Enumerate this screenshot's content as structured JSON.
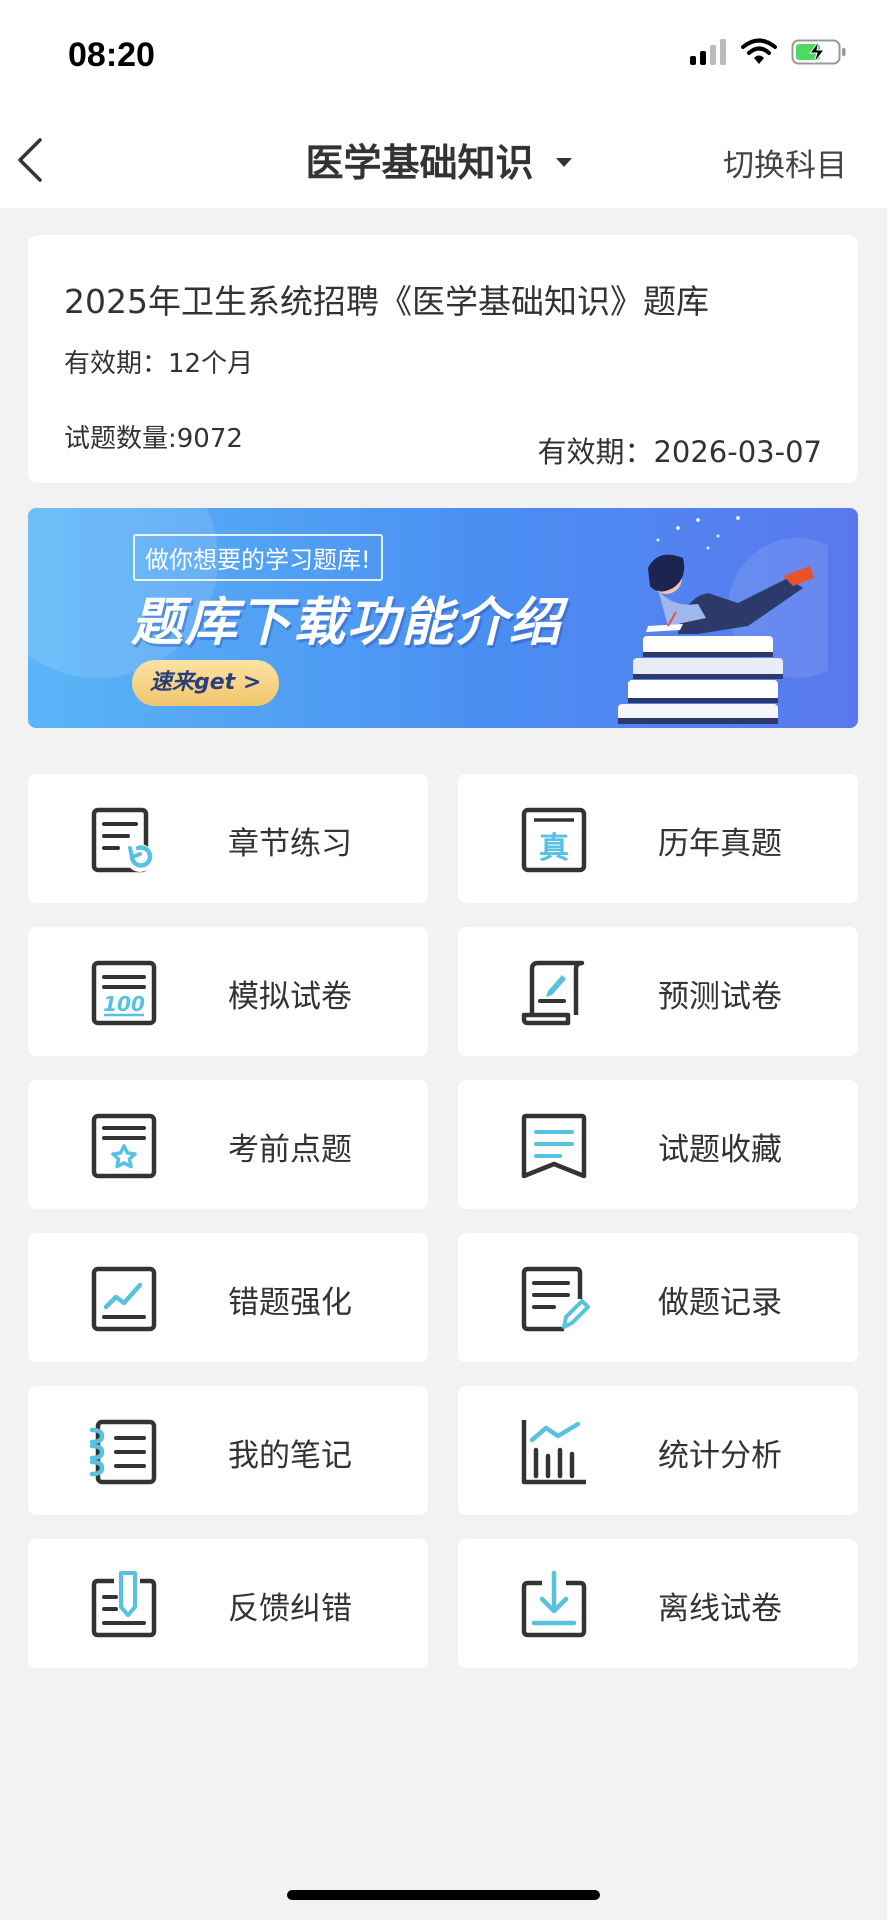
{
  "status_bar": {
    "time": "08:20"
  },
  "nav": {
    "title": "医学基础知识",
    "switch_label": "切换科目"
  },
  "card": {
    "title": "2025年卫生系统招聘《医学基础知识》题库",
    "validity": "有效期：12个月",
    "question_count": "试题数量:9072",
    "expire_date": "有效期：2026-03-07"
  },
  "banner": {
    "subtitle": "做你想要的学习题库!",
    "title": "题库下载功能介绍",
    "button": "速来get >"
  },
  "menu": [
    {
      "label": "章节练习",
      "icon": "chapter-practice-icon"
    },
    {
      "label": "历年真题",
      "icon": "past-papers-icon"
    },
    {
      "label": "模拟试卷",
      "icon": "mock-exam-icon"
    },
    {
      "label": "预测试卷",
      "icon": "prediction-exam-icon"
    },
    {
      "label": "考前点题",
      "icon": "pre-exam-tips-icon"
    },
    {
      "label": "试题收藏",
      "icon": "favorites-icon"
    },
    {
      "label": "错题强化",
      "icon": "wrong-questions-icon"
    },
    {
      "label": "做题记录",
      "icon": "practice-record-icon"
    },
    {
      "label": "我的笔记",
      "icon": "notes-icon"
    },
    {
      "label": "统计分析",
      "icon": "statistics-icon"
    },
    {
      "label": "反馈纠错",
      "icon": "feedback-icon"
    },
    {
      "label": "离线试卷",
      "icon": "offline-exam-icon"
    }
  ],
  "colors": {
    "accent": "#56c1e0",
    "icon_stroke": "#333333",
    "background": "#f2f2f2"
  }
}
